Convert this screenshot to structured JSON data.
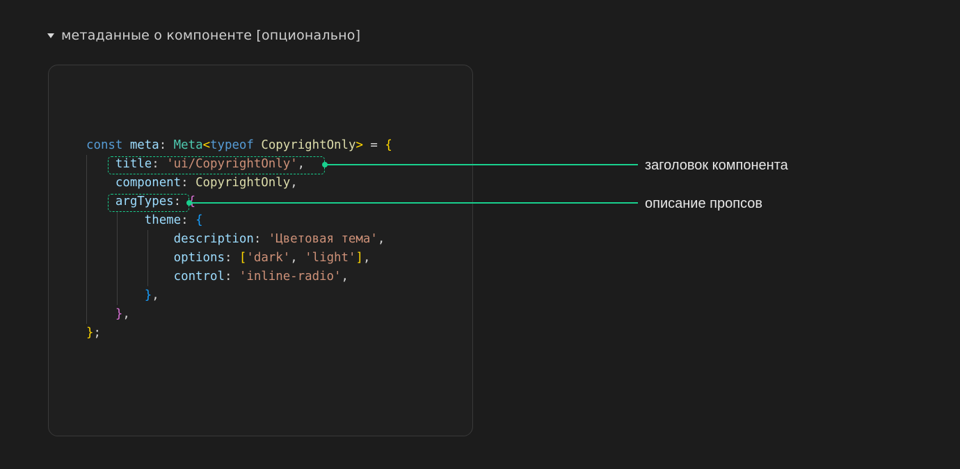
{
  "section": {
    "title": "метаданные о компоненте [опционально]"
  },
  "code": {
    "lines": [
      [
        {
          "t": "kw",
          "v": "const "
        },
        {
          "t": "var",
          "v": "meta"
        },
        {
          "t": "plain",
          "v": ": "
        },
        {
          "t": "type",
          "v": "Meta"
        },
        {
          "t": "p1",
          "v": "<"
        },
        {
          "t": "kw",
          "v": "typeof "
        },
        {
          "t": "fn",
          "v": "CopyrightOnly"
        },
        {
          "t": "p1",
          "v": ">"
        },
        {
          "t": "plain",
          "v": " = "
        },
        {
          "t": "p1",
          "v": "{"
        }
      ],
      [
        {
          "t": "plain",
          "v": "    "
        },
        {
          "t": "var",
          "v": "title"
        },
        {
          "t": "plain",
          "v": ": "
        },
        {
          "t": "str",
          "v": "'ui/CopyrightOnly'"
        },
        {
          "t": "plain",
          "v": ","
        }
      ],
      [
        {
          "t": "plain",
          "v": "    "
        },
        {
          "t": "var",
          "v": "component"
        },
        {
          "t": "plain",
          "v": ": "
        },
        {
          "t": "fn",
          "v": "CopyrightOnly"
        },
        {
          "t": "plain",
          "v": ","
        }
      ],
      [
        {
          "t": "plain",
          "v": "    "
        },
        {
          "t": "var",
          "v": "argTypes"
        },
        {
          "t": "plain",
          "v": ": "
        },
        {
          "t": "p2",
          "v": "{"
        }
      ],
      [
        {
          "t": "plain",
          "v": "        "
        },
        {
          "t": "var",
          "v": "theme"
        },
        {
          "t": "plain",
          "v": ": "
        },
        {
          "t": "p3",
          "v": "{"
        }
      ],
      [
        {
          "t": "plain",
          "v": "            "
        },
        {
          "t": "var",
          "v": "description"
        },
        {
          "t": "plain",
          "v": ": "
        },
        {
          "t": "str",
          "v": "'Цветовая тема'"
        },
        {
          "t": "plain",
          "v": ","
        }
      ],
      [
        {
          "t": "plain",
          "v": "            "
        },
        {
          "t": "var",
          "v": "options"
        },
        {
          "t": "plain",
          "v": ": "
        },
        {
          "t": "p1",
          "v": "["
        },
        {
          "t": "str",
          "v": "'dark'"
        },
        {
          "t": "plain",
          "v": ", "
        },
        {
          "t": "str",
          "v": "'light'"
        },
        {
          "t": "p1",
          "v": "]"
        },
        {
          "t": "plain",
          "v": ","
        }
      ],
      [
        {
          "t": "plain",
          "v": "            "
        },
        {
          "t": "var",
          "v": "control"
        },
        {
          "t": "plain",
          "v": ": "
        },
        {
          "t": "str",
          "v": "'inline-radio'"
        },
        {
          "t": "plain",
          "v": ","
        }
      ],
      [
        {
          "t": "plain",
          "v": "        "
        },
        {
          "t": "p3",
          "v": "}"
        },
        {
          "t": "plain",
          "v": ","
        }
      ],
      [
        {
          "t": "plain",
          "v": "    "
        },
        {
          "t": "p2",
          "v": "}"
        },
        {
          "t": "plain",
          "v": ","
        }
      ],
      [
        {
          "t": "p1",
          "v": "}"
        },
        {
          "t": "plain",
          "v": ";"
        }
      ]
    ]
  },
  "annotations": {
    "title_label": "заголовок компонента",
    "argtypes_label": "описание пропсов"
  },
  "colors": {
    "accent": "#19d08e",
    "keyword": "#569cd6",
    "variable": "#9cdcfe",
    "type": "#4ec9b0",
    "function": "#dcdcaa",
    "string": "#ce9178",
    "bracket_1": "#ffd700",
    "bracket_2": "#da70d6",
    "bracket_3": "#179fff"
  }
}
